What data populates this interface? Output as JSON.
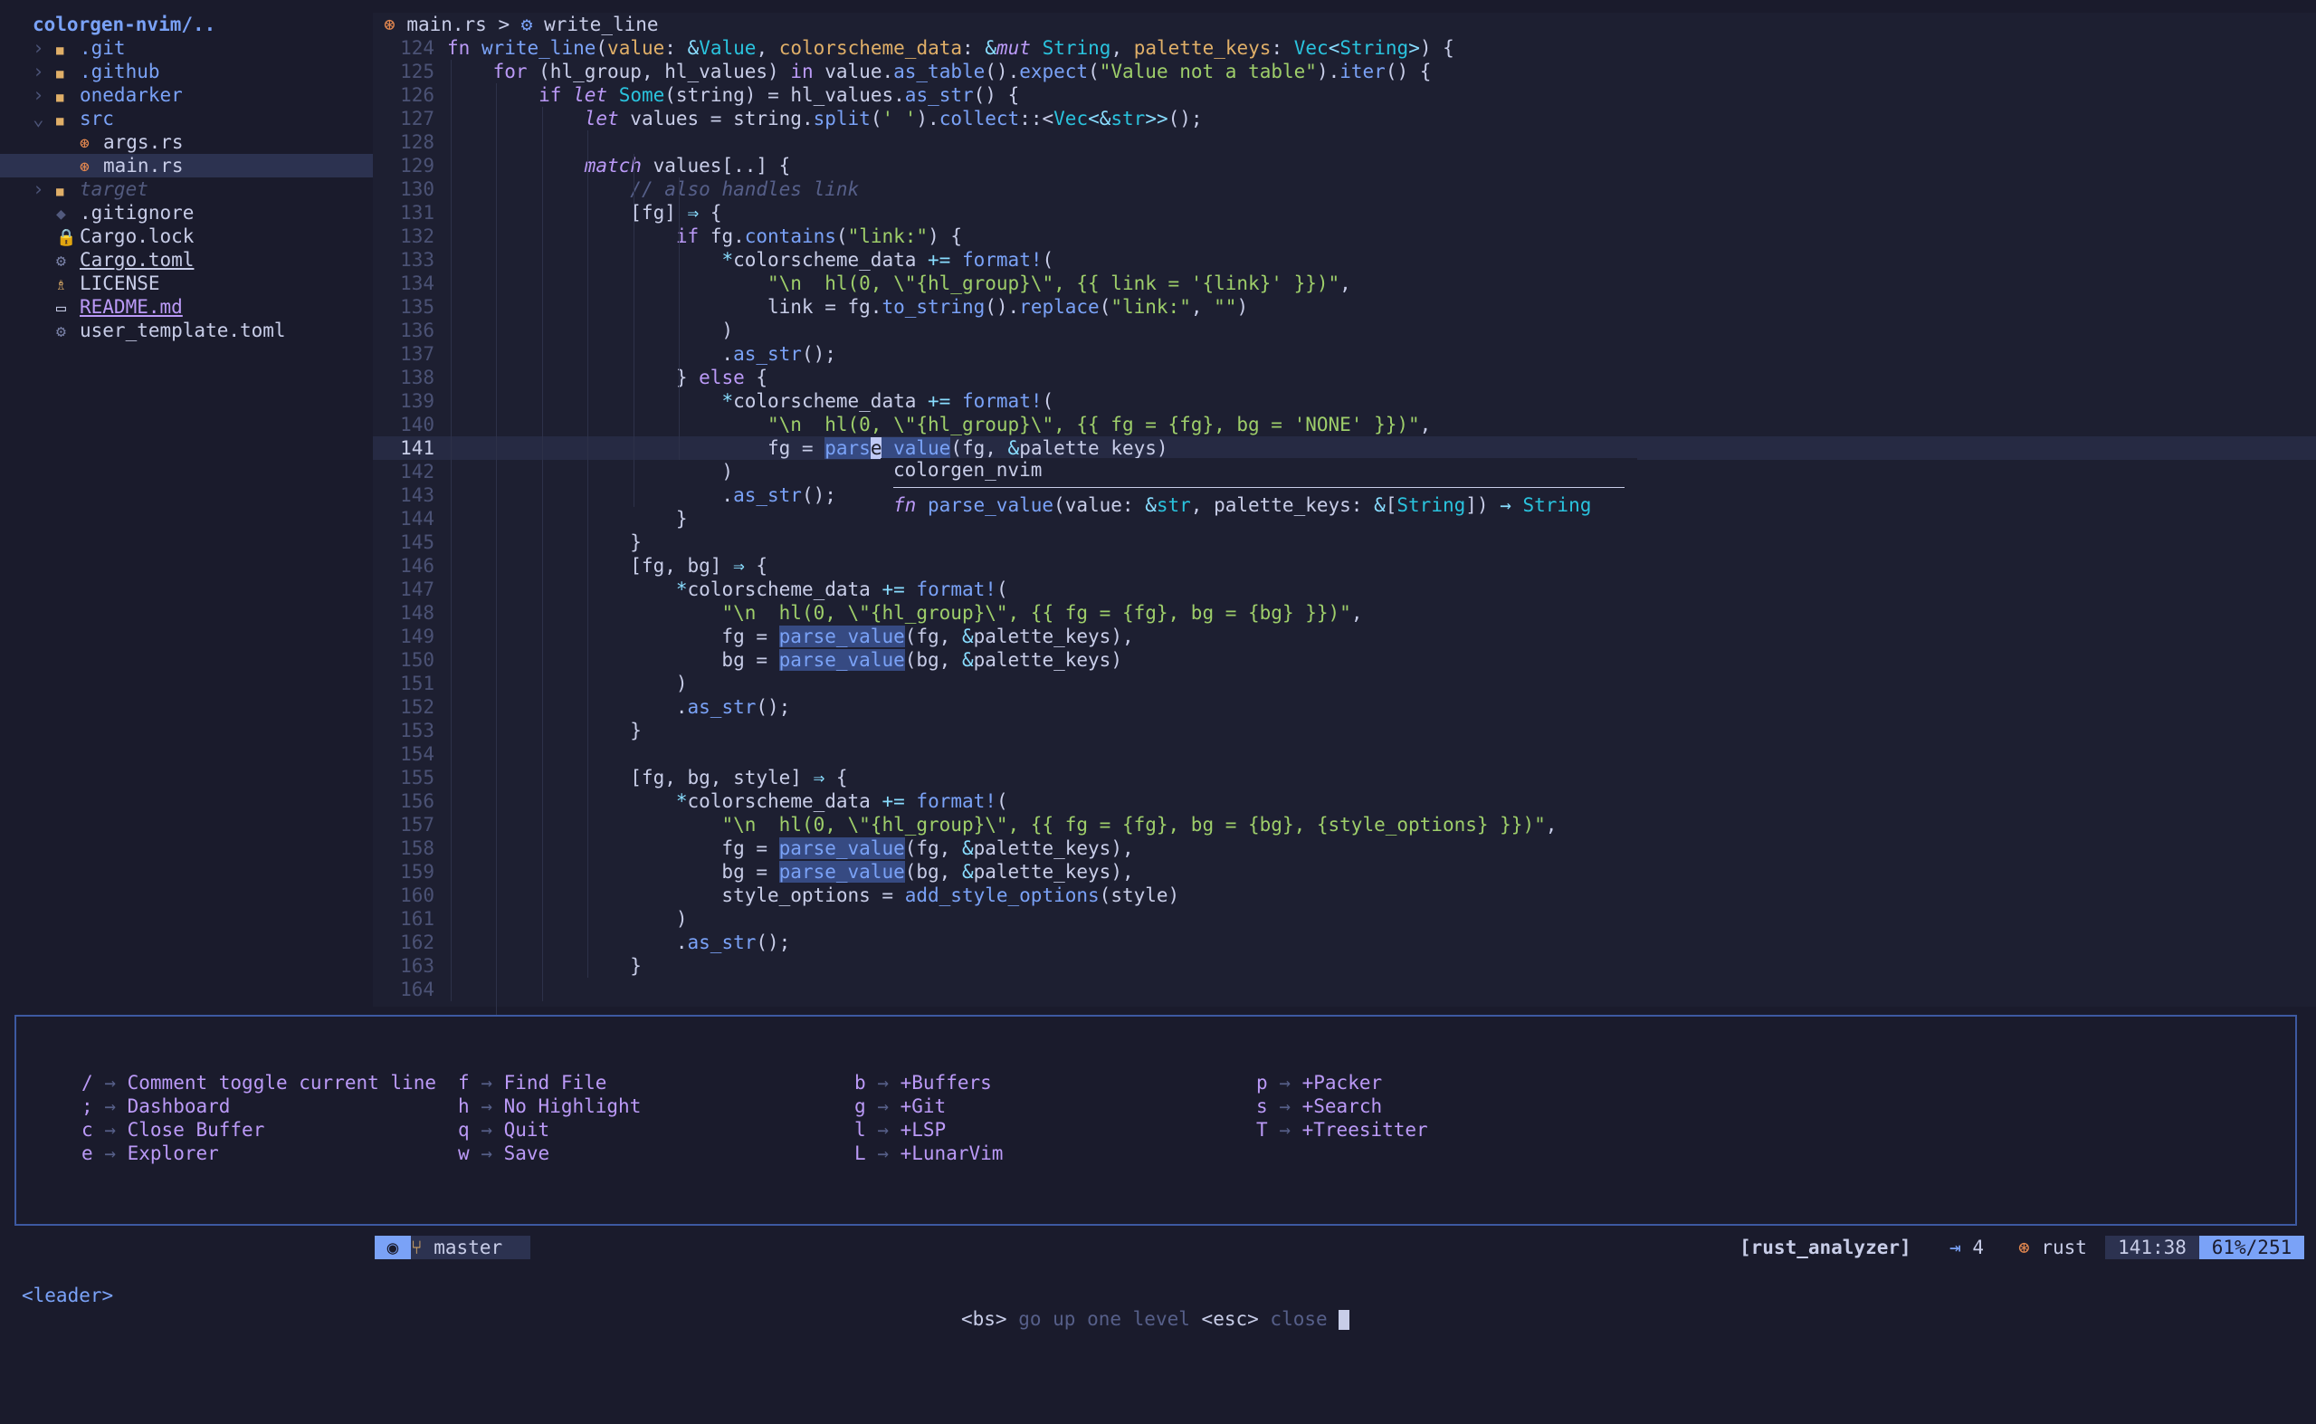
{
  "tree": {
    "root": "colorgen-nvim/..",
    "items": [
      {
        "name": ".git",
        "icon": "folder-icon",
        "twisty": "›",
        "cls": "dir",
        "sel": false,
        "indent": 0
      },
      {
        "name": ".github",
        "icon": "folder-icon",
        "twisty": "›",
        "cls": "dir",
        "sel": false,
        "indent": 0
      },
      {
        "name": "onedarker",
        "icon": "folder-icon",
        "twisty": "›",
        "cls": "dir",
        "sel": false,
        "indent": 0
      },
      {
        "name": "src",
        "icon": "folder-open-icon",
        "twisty": "⌄",
        "cls": "dir",
        "sel": false,
        "indent": 0
      },
      {
        "name": "args.rs",
        "icon": "rust-file-icon",
        "twisty": "",
        "cls": "",
        "sel": false,
        "indent": 1
      },
      {
        "name": "main.rs",
        "icon": "rust-file-icon",
        "twisty": "",
        "cls": "",
        "sel": true,
        "indent": 1
      },
      {
        "name": "target",
        "icon": "folder-icon",
        "twisty": "›",
        "cls": "dim",
        "sel": false,
        "indent": 0
      },
      {
        "name": ".gitignore",
        "icon": "git-icon",
        "twisty": "",
        "cls": "",
        "sel": false,
        "indent": 0
      },
      {
        "name": "Cargo.lock",
        "icon": "lock-icon",
        "twisty": "",
        "cls": "",
        "sel": false,
        "indent": 0
      },
      {
        "name": "Cargo.toml",
        "icon": "gear-icon",
        "twisty": "",
        "cls": "ul",
        "sel": false,
        "indent": 0
      },
      {
        "name": "LICENSE",
        "icon": "license-icon",
        "twisty": "",
        "cls": "",
        "sel": false,
        "indent": 0
      },
      {
        "name": "README.md",
        "icon": "markdown-icon",
        "twisty": "",
        "cls": "ul purple",
        "sel": false,
        "indent": 0
      },
      {
        "name": "user_template.toml",
        "icon": "gear-icon",
        "twisty": "",
        "cls": "",
        "sel": false,
        "indent": 0
      }
    ]
  },
  "editor": {
    "breadcrumb": {
      "file": "main.rs",
      "sep": ">",
      "symbol": "write_line"
    },
    "current_line": 141,
    "lines": [
      {
        "n": 124,
        "code": [
          [
            "kw",
            "fn"
          ],
          [
            "t",
            " "
          ],
          [
            "fn",
            "write_line"
          ],
          [
            "t",
            "("
          ],
          [
            "pa",
            "value"
          ],
          [
            "t",
            ": "
          ],
          [
            "op",
            "&"
          ],
          [
            "ty",
            "Value"
          ],
          [
            "t",
            ", "
          ],
          [
            "pa",
            "colorscheme_data"
          ],
          [
            "t",
            ": "
          ],
          [
            "op",
            "&"
          ],
          [
            "kw it",
            "mut"
          ],
          [
            "t",
            " "
          ],
          [
            "ty",
            "String"
          ],
          [
            "t",
            ", "
          ],
          [
            "pa",
            "palette_keys"
          ],
          [
            "t",
            ": "
          ],
          [
            "ty",
            "Vec"
          ],
          [
            "op",
            "<"
          ],
          [
            "ty",
            "String"
          ],
          [
            "op",
            ">"
          ],
          [
            "t",
            ") {"
          ]
        ]
      },
      {
        "n": 125,
        "code": [
          [
            "t",
            "    "
          ],
          [
            "kw",
            "for"
          ],
          [
            "t",
            " (hl_group, hl_values) "
          ],
          [
            "kw",
            "in"
          ],
          [
            "t",
            " value."
          ],
          [
            "fn",
            "as_table"
          ],
          [
            "t",
            "()."
          ],
          [
            "fn",
            "expect"
          ],
          [
            "t",
            "("
          ],
          [
            "st",
            "\"Value not a table\""
          ],
          [
            "t",
            ")."
          ],
          [
            "fn",
            "iter"
          ],
          [
            "t",
            "() {"
          ]
        ]
      },
      {
        "n": 126,
        "code": [
          [
            "t",
            "        "
          ],
          [
            "kw",
            "if"
          ],
          [
            "t",
            " "
          ],
          [
            "kw it",
            "let"
          ],
          [
            "t",
            " "
          ],
          [
            "ty",
            "Some"
          ],
          [
            "t",
            "(string) = hl_values."
          ],
          [
            "fn",
            "as_str"
          ],
          [
            "t",
            "() {"
          ]
        ]
      },
      {
        "n": 127,
        "code": [
          [
            "t",
            "            "
          ],
          [
            "kw it",
            "let"
          ],
          [
            "t",
            " values = string."
          ],
          [
            "fn",
            "split"
          ],
          [
            "t",
            "("
          ],
          [
            "st",
            "' '"
          ],
          [
            "t",
            ")."
          ],
          [
            "fn",
            "collect"
          ],
          [
            "t",
            "::<"
          ],
          [
            "ty",
            "Vec"
          ],
          [
            "op",
            "<&"
          ],
          [
            "ty",
            "str"
          ],
          [
            "op",
            ">>"
          ],
          [
            "t",
            "();"
          ]
        ]
      },
      {
        "n": 128,
        "code": []
      },
      {
        "n": 129,
        "code": [
          [
            "t",
            "            "
          ],
          [
            "kw it",
            "match"
          ],
          [
            "t",
            " values[..] {"
          ]
        ]
      },
      {
        "n": 130,
        "code": [
          [
            "t",
            "                "
          ],
          [
            "cm",
            "// also handles link"
          ]
        ]
      },
      {
        "n": 131,
        "code": [
          [
            "t",
            "                [fg] "
          ],
          [
            "op",
            "⇒"
          ],
          [
            "t",
            " {"
          ]
        ]
      },
      {
        "n": 132,
        "code": [
          [
            "t",
            "                    "
          ],
          [
            "kw",
            "if"
          ],
          [
            "t",
            " fg."
          ],
          [
            "fn",
            "contains"
          ],
          [
            "t",
            "("
          ],
          [
            "st",
            "\"link:\""
          ],
          [
            "t",
            ") {"
          ]
        ]
      },
      {
        "n": 133,
        "code": [
          [
            "t",
            "                        "
          ],
          [
            "op",
            "*"
          ],
          [
            "t",
            "colorscheme_data "
          ],
          [
            "op",
            "+="
          ],
          [
            "t",
            " "
          ],
          [
            "fn",
            "format!"
          ],
          [
            "t",
            "("
          ]
        ]
      },
      {
        "n": 134,
        "code": [
          [
            "t",
            "                            "
          ],
          [
            "st",
            "\"\\n  hl(0, \\\"{hl_group}\\\", {{ link = '{link}' }})\""
          ],
          [
            "t",
            ","
          ]
        ]
      },
      {
        "n": 135,
        "code": [
          [
            "t",
            "                            link = fg."
          ],
          [
            "fn",
            "to_string"
          ],
          [
            "t",
            "()."
          ],
          [
            "fn",
            "replace"
          ],
          [
            "t",
            "("
          ],
          [
            "st",
            "\"link:\""
          ],
          [
            "t",
            ", "
          ],
          [
            "st",
            "\"\""
          ],
          [
            "t",
            ")"
          ]
        ]
      },
      {
        "n": 136,
        "code": [
          [
            "t",
            "                        )"
          ]
        ]
      },
      {
        "n": 137,
        "code": [
          [
            "t",
            "                        ."
          ],
          [
            "fn",
            "as_str"
          ],
          [
            "t",
            "();"
          ]
        ]
      },
      {
        "n": 138,
        "code": [
          [
            "t",
            "                    } "
          ],
          [
            "kw",
            "else"
          ],
          [
            "t",
            " {"
          ]
        ]
      },
      {
        "n": 139,
        "code": [
          [
            "t",
            "                        "
          ],
          [
            "op",
            "*"
          ],
          [
            "t",
            "colorscheme_data "
          ],
          [
            "op",
            "+="
          ],
          [
            "t",
            " "
          ],
          [
            "fn",
            "format!"
          ],
          [
            "t",
            "("
          ]
        ]
      },
      {
        "n": 140,
        "code": [
          [
            "t",
            "                            "
          ],
          [
            "st",
            "\"\\n  hl(0, \\\"{hl_group}\\\", {{ fg = {fg}, bg = 'NONE' }})\""
          ],
          [
            "t",
            ","
          ]
        ]
      },
      {
        "n": 141,
        "code": [
          [
            "t",
            "                            fg = "
          ],
          [
            "fn hlw",
            "pars"
          ],
          [
            "cursor",
            "e"
          ],
          [
            "fn hlw",
            "_value"
          ],
          [
            "t",
            "(fg, "
          ],
          [
            "op",
            "&"
          ],
          [
            "t",
            "palette_keys)"
          ]
        ]
      },
      {
        "n": 142,
        "code": [
          [
            "t",
            "                        )"
          ]
        ]
      },
      {
        "n": 143,
        "code": [
          [
            "t",
            "                        ."
          ],
          [
            "fn",
            "as_str"
          ],
          [
            "t",
            "();"
          ]
        ]
      },
      {
        "n": 144,
        "code": [
          [
            "t",
            "                    }"
          ]
        ]
      },
      {
        "n": 145,
        "code": [
          [
            "t",
            "                }"
          ]
        ]
      },
      {
        "n": 146,
        "code": [
          [
            "t",
            "                [fg, bg] "
          ],
          [
            "op",
            "⇒"
          ],
          [
            "t",
            " {"
          ]
        ]
      },
      {
        "n": 147,
        "code": [
          [
            "t",
            "                    "
          ],
          [
            "op",
            "*"
          ],
          [
            "t",
            "colorscheme_data "
          ],
          [
            "op",
            "+="
          ],
          [
            "t",
            " "
          ],
          [
            "fn",
            "format!"
          ],
          [
            "t",
            "("
          ]
        ]
      },
      {
        "n": 148,
        "code": [
          [
            "t",
            "                        "
          ],
          [
            "st",
            "\"\\n  hl(0, \\\"{hl_group}\\\", {{ fg = {fg}, bg = {bg} }})\""
          ],
          [
            "t",
            ","
          ]
        ]
      },
      {
        "n": 149,
        "code": [
          [
            "t",
            "                        fg = "
          ],
          [
            "fn hlw",
            "parse_value"
          ],
          [
            "t",
            "(fg, "
          ],
          [
            "op",
            "&"
          ],
          [
            "t",
            "palette_keys),"
          ]
        ]
      },
      {
        "n": 150,
        "code": [
          [
            "t",
            "                        bg = "
          ],
          [
            "fn hlw",
            "parse_value"
          ],
          [
            "t",
            "(bg, "
          ],
          [
            "op",
            "&"
          ],
          [
            "t",
            "palette_keys)"
          ]
        ]
      },
      {
        "n": 151,
        "code": [
          [
            "t",
            "                    )"
          ]
        ]
      },
      {
        "n": 152,
        "code": [
          [
            "t",
            "                    ."
          ],
          [
            "fn",
            "as_str"
          ],
          [
            "t",
            "();"
          ]
        ]
      },
      {
        "n": 153,
        "code": [
          [
            "t",
            "                }"
          ]
        ]
      },
      {
        "n": 154,
        "code": []
      },
      {
        "n": 155,
        "code": [
          [
            "t",
            "                [fg, bg, style] "
          ],
          [
            "op",
            "⇒"
          ],
          [
            "t",
            " {"
          ]
        ]
      },
      {
        "n": 156,
        "code": [
          [
            "t",
            "                    "
          ],
          [
            "op",
            "*"
          ],
          [
            "t",
            "colorscheme_data "
          ],
          [
            "op",
            "+="
          ],
          [
            "t",
            " "
          ],
          [
            "fn",
            "format!"
          ],
          [
            "t",
            "("
          ]
        ]
      },
      {
        "n": 157,
        "code": [
          [
            "t",
            "                        "
          ],
          [
            "st",
            "\"\\n  hl(0, \\\"{hl_group}\\\", {{ fg = {fg}, bg = {bg}, {style_options} }})\""
          ],
          [
            "t",
            ","
          ]
        ]
      },
      {
        "n": 158,
        "code": [
          [
            "t",
            "                        fg = "
          ],
          [
            "fn hlw",
            "parse_value"
          ],
          [
            "t",
            "(fg, "
          ],
          [
            "op",
            "&"
          ],
          [
            "t",
            "palette_keys),"
          ]
        ]
      },
      {
        "n": 159,
        "code": [
          [
            "t",
            "                        bg = "
          ],
          [
            "fn hlw",
            "parse_value"
          ],
          [
            "t",
            "(bg, "
          ],
          [
            "op",
            "&"
          ],
          [
            "t",
            "palette_keys),"
          ]
        ]
      },
      {
        "n": 160,
        "code": [
          [
            "t",
            "                        style_options = "
          ],
          [
            "fn",
            "add_style_options"
          ],
          [
            "t",
            "(style)"
          ]
        ]
      },
      {
        "n": 161,
        "code": [
          [
            "t",
            "                    )"
          ]
        ]
      },
      {
        "n": 162,
        "code": [
          [
            "t",
            "                    ."
          ],
          [
            "fn",
            "as_str"
          ],
          [
            "t",
            "();"
          ]
        ]
      },
      {
        "n": 163,
        "code": [
          [
            "t",
            "                }"
          ]
        ]
      },
      {
        "n": 164,
        "code": []
      }
    ]
  },
  "hover": {
    "crate": "colorgen_nvim",
    "signature": [
      [
        "kw it",
        "fn"
      ],
      [
        "t",
        " "
      ],
      [
        "fn",
        "parse_value"
      ],
      [
        "t",
        "(value: "
      ],
      [
        "op",
        "&"
      ],
      [
        "ty",
        "str"
      ],
      [
        "t",
        ", palette_keys: "
      ],
      [
        "op",
        "&"
      ],
      [
        "t",
        "["
      ],
      [
        "ty",
        "String"
      ],
      [
        "t",
        "]) "
      ],
      [
        "op",
        "→"
      ],
      [
        "t",
        " "
      ],
      [
        "ty",
        "String"
      ]
    ]
  },
  "whichkey": {
    "arrow": "→",
    "columns": [
      [
        {
          "key": "/",
          "label": "Comment toggle current line"
        },
        {
          "key": ";",
          "label": "Dashboard"
        },
        {
          "key": "c",
          "label": "Close Buffer"
        },
        {
          "key": "e",
          "label": "Explorer"
        }
      ],
      [
        {
          "key": "f",
          "label": "Find File"
        },
        {
          "key": "h",
          "label": "No Highlight"
        },
        {
          "key": "q",
          "label": "Quit"
        },
        {
          "key": "w",
          "label": "Save"
        }
      ],
      [
        {
          "key": "b",
          "label": "+Buffers"
        },
        {
          "key": "g",
          "label": "+Git"
        },
        {
          "key": "l",
          "label": "+LSP"
        },
        {
          "key": "L",
          "label": "+LunarVim"
        }
      ],
      [
        {
          "key": "p",
          "label": "+Packer"
        },
        {
          "key": "s",
          "label": "+Search"
        },
        {
          "key": "T",
          "label": "+Treesitter"
        }
      ]
    ]
  },
  "status": {
    "mode_icon": "◉",
    "branch_icon": "⑂",
    "branch": "master",
    "lsp": "[rust_analyzer]",
    "tab_icon": "⇥",
    "indent": "4",
    "ft_icon": "⊛",
    "filetype": "rust",
    "position": "141:38",
    "progress": "61%/251"
  },
  "cmdline": {
    "leader": "<leader>",
    "bs_key": "<bs>",
    "bs_label": "go up one level",
    "esc_key": "<esc>",
    "esc_label": "close"
  },
  "colors": {
    "background": "#1a1b2c",
    "accent": "#7aa2f7",
    "keyword": "#bb9af7",
    "string": "#9ece6a",
    "type": "#2ac3de",
    "param": "#e0af68",
    "border": "#3d59a1"
  }
}
